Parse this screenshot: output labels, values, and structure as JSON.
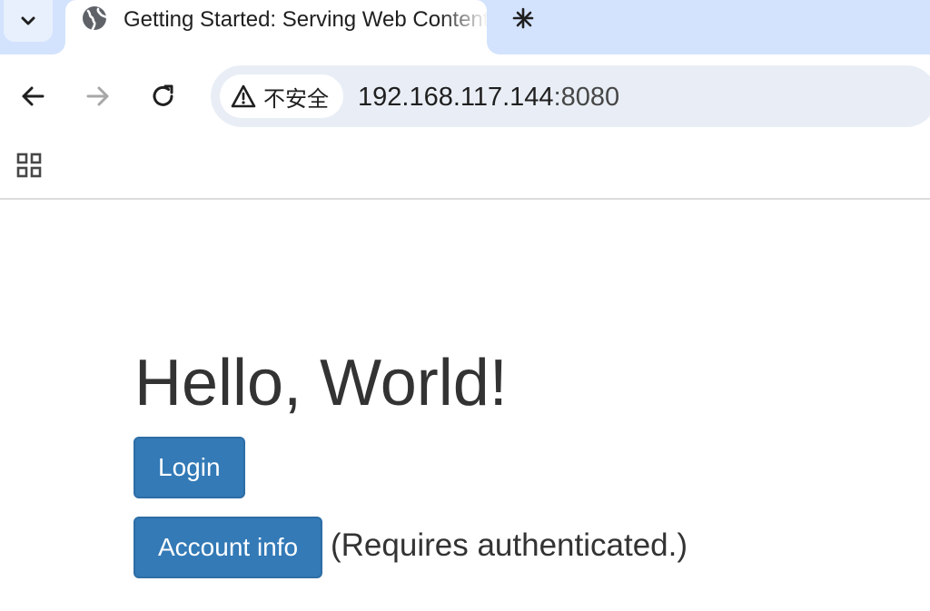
{
  "browser": {
    "tab": {
      "title": "Getting Started: Serving Web Content"
    },
    "omnibox": {
      "security_label": "不安全",
      "url_host": "192.168.117.144",
      "url_port": ":8080"
    }
  },
  "page": {
    "heading": "Hello, World!",
    "login_label": "Login",
    "account_label": "Account info",
    "auth_note": "(Requires authenticated.)"
  },
  "colors": {
    "tabstrip_bg": "#d3e3fd",
    "omnibox_bg": "#e9eef6",
    "button_primary": "#337ab7",
    "text_heading": "#333333"
  },
  "icons": {
    "tab_search": "chevron-down-icon",
    "favicon": "globe-icon",
    "tab_close": "close-icon",
    "new_tab": "plus-icon",
    "back": "arrow-left-icon",
    "forward": "arrow-right-icon",
    "reload": "reload-icon",
    "security": "warning-triangle-icon",
    "apps": "apps-grid-icon"
  }
}
